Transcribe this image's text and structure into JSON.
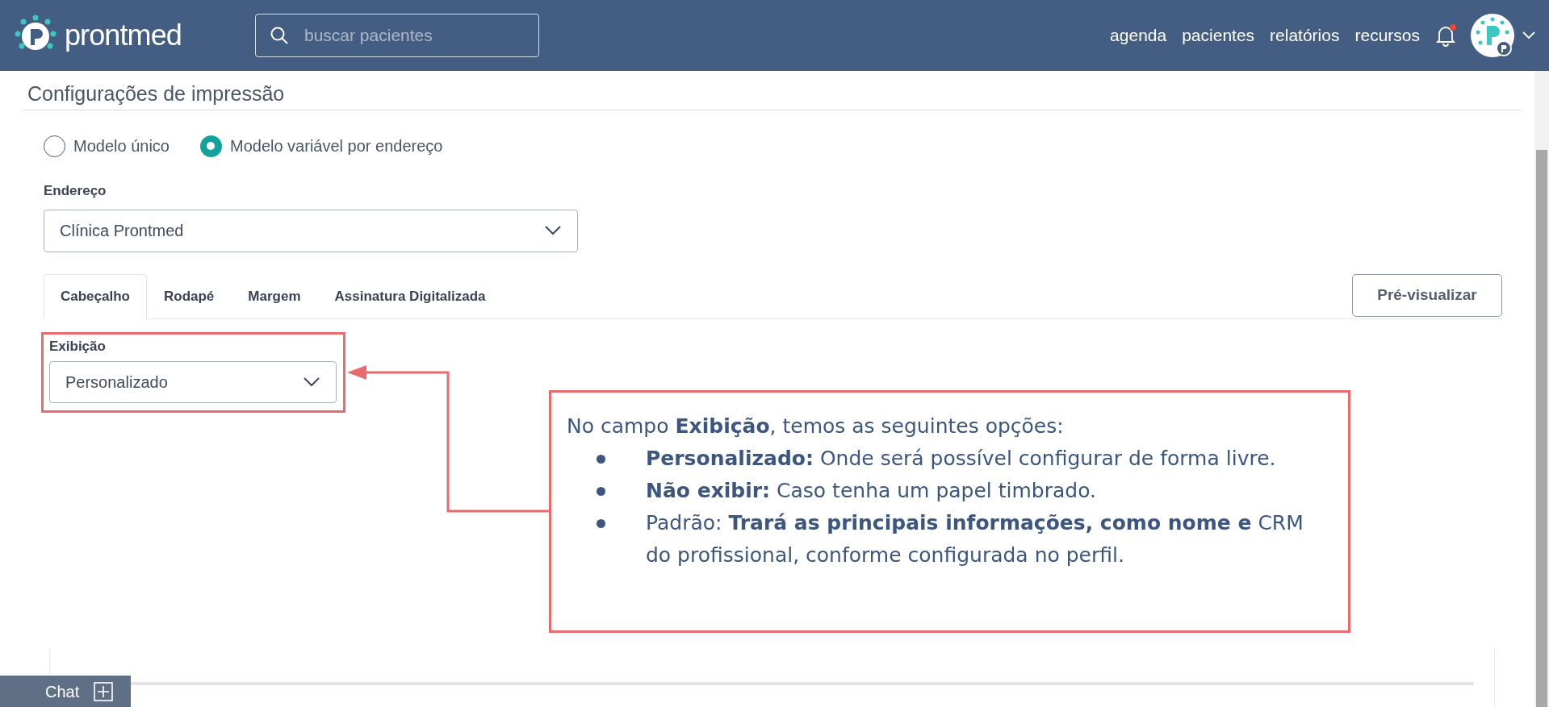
{
  "header": {
    "brand": "prontmed",
    "search": {
      "placeholder": "buscar pacientes"
    },
    "nav": [
      "agenda",
      "pacientes",
      "relatórios",
      "recursos"
    ],
    "notification_dot": true
  },
  "page_title": "Configurações de impressão",
  "model_options": [
    {
      "label": "Modelo único",
      "selected": false
    },
    {
      "label": "Modelo variável por endereço",
      "selected": true
    }
  ],
  "address": {
    "label": "Endereço",
    "value": "Clínica Prontmed"
  },
  "tabs": [
    {
      "label": "Cabeçalho",
      "selected": true
    },
    {
      "label": "Rodapé",
      "selected": false
    },
    {
      "label": "Margem",
      "selected": false
    },
    {
      "label": "Assinatura Digitalizada",
      "selected": false
    }
  ],
  "preview_button": "Pré-visualizar",
  "display": {
    "label": "Exibição",
    "value": "Personalizado"
  },
  "callout": {
    "intro": "No campo **Exibição**, temos as seguintes opções:",
    "items": [
      "**Personalizado:** Onde será possível configurar de forma livre.",
      "**Não exibir:** Caso tenha um papel timbrado.",
      "Padrão: **Trará as principais informações, como nome e** CRM do profissional, conforme configurada no perfil."
    ]
  },
  "chat": {
    "label": "Chat"
  }
}
